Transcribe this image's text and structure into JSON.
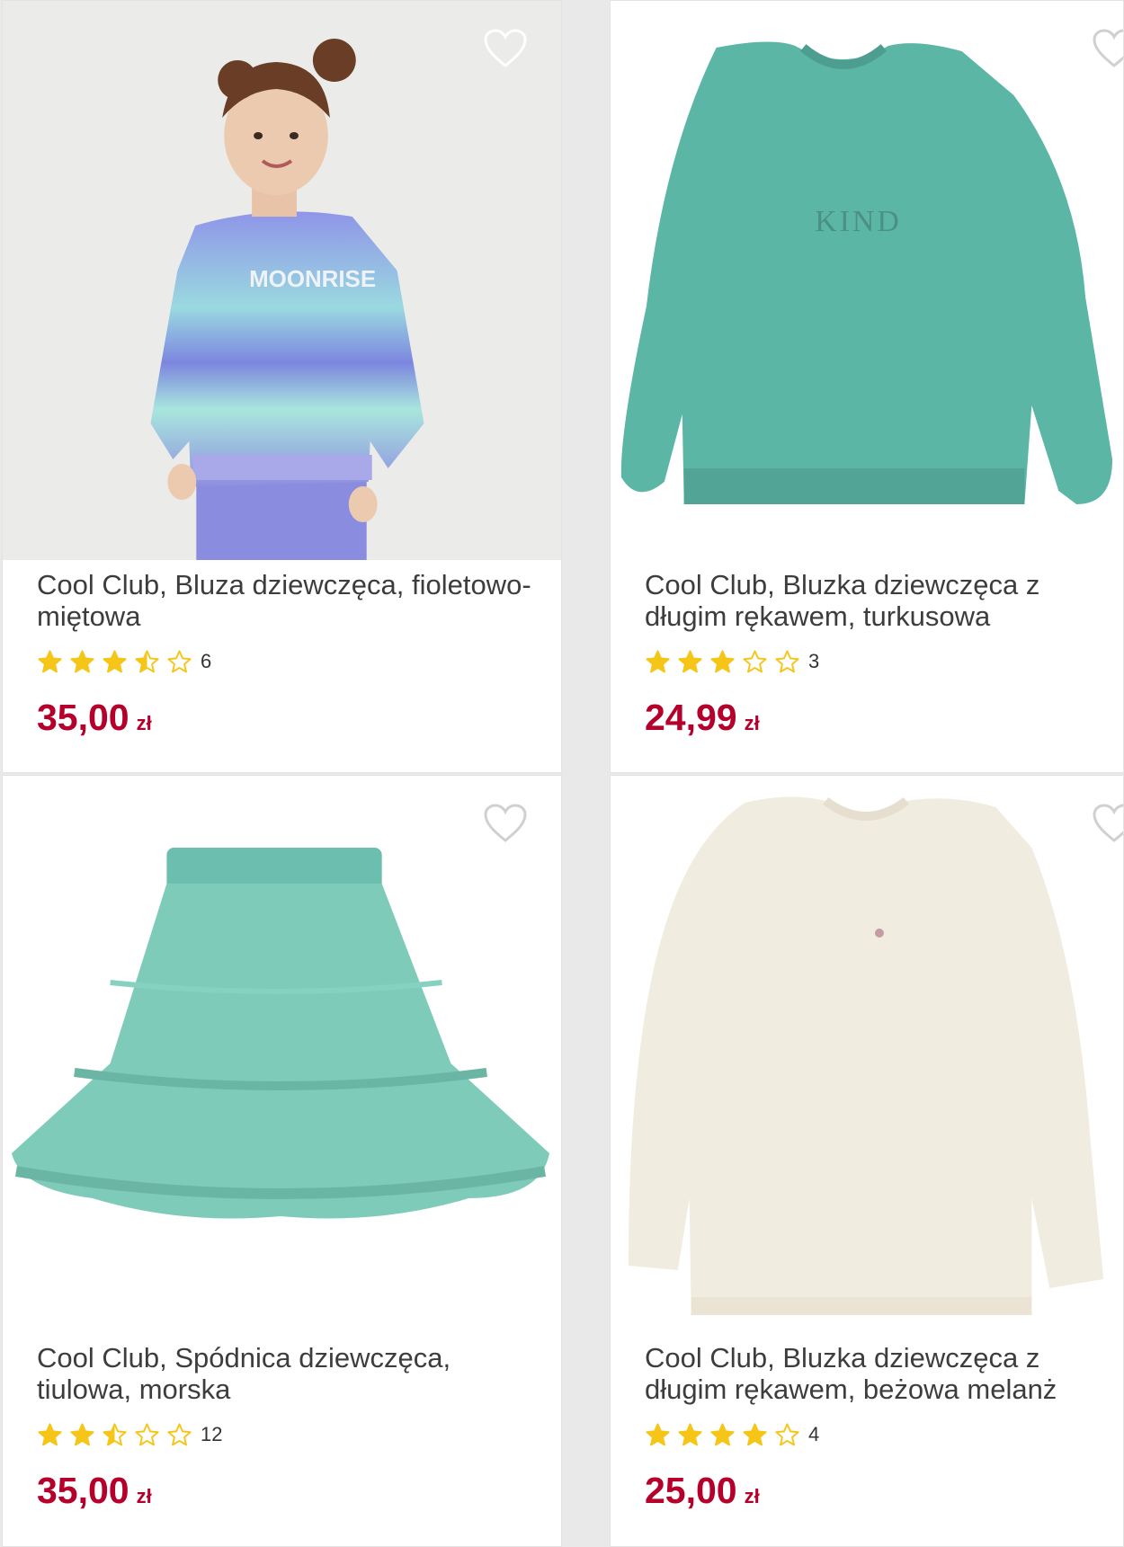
{
  "products": [
    {
      "title": "Cool Club, Bluza dziewczęca, fioletowo-miętowa",
      "rating": 3.5,
      "reviews": "6",
      "price": "35,00",
      "currency": "zł",
      "print_text": "MOONRISE",
      "favorite_icon": "heart-outline-icon"
    },
    {
      "title": "Cool Club, Bluzka dziewczęca z długim rękawem, turkusowa",
      "rating": 3,
      "reviews": "3",
      "price": "24,99",
      "currency": "zł",
      "print_text": "KIND",
      "favorite_icon": "heart-outline-icon"
    },
    {
      "title": "Cool Club, Spódnica dziewczęca, tiulowa, morska",
      "rating": 2.5,
      "reviews": "12",
      "price": "35,00",
      "currency": "zł",
      "favorite_icon": "heart-outline-icon"
    },
    {
      "title": "Cool Club, Bluzka dziewczęca z długim rękawem, beżowa melanż",
      "rating": 4,
      "reviews": "4",
      "price": "25,00",
      "currency": "zł",
      "favorite_icon": "heart-outline-icon"
    }
  ],
  "colors": {
    "price": "#b5002b",
    "star": "#f5c518",
    "title": "#3d3d3d"
  }
}
